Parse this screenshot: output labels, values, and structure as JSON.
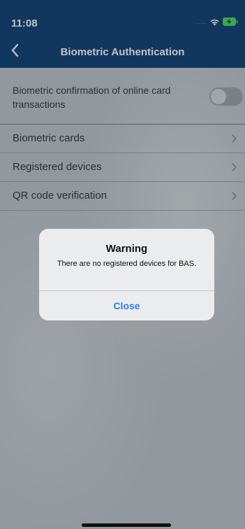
{
  "status_bar": {
    "time": "11:08"
  },
  "nav": {
    "title": "Biometric Authentication"
  },
  "settings": {
    "toggle_label": "Biometric confirmation of online card transactions",
    "toggle_on": false
  },
  "menu": {
    "items": [
      {
        "label": "Biometric cards"
      },
      {
        "label": "Registered devices"
      },
      {
        "label": "QR code verification"
      }
    ]
  },
  "alert": {
    "title": "Warning",
    "message": "There are no registered devices for BAS.",
    "button_label": "Close"
  },
  "colors": {
    "header": "#0f3f74",
    "accent": "#2f7de1",
    "battery": "#4cd964"
  }
}
